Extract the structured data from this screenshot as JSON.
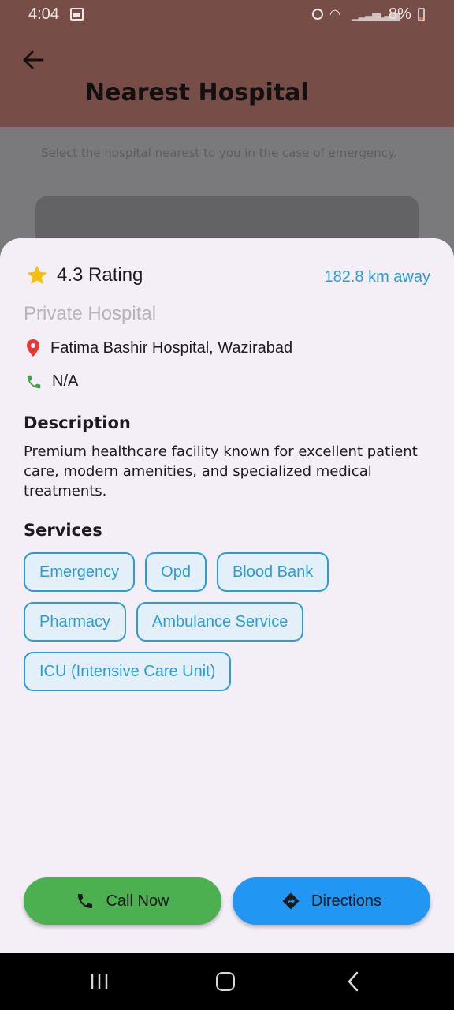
{
  "status_bar": {
    "time": "4:04",
    "battery": "8%"
  },
  "app_bar": {
    "title": "Nearest Hospital"
  },
  "background": {
    "subtitle": "Select the hospital nearest to you in the case of emergency."
  },
  "sheet": {
    "rating": "4.3 Rating",
    "distance": "182.8 km away",
    "type": "Private Hospital",
    "address": "Fatima Bashir Hospital, Wazirabad",
    "phone": "N/A",
    "description_title": "Description",
    "description": "Premium healthcare facility known for excellent patient care, modern amenities, and specialized medical treatments.",
    "services_title": "Services",
    "services": [
      "Emergency",
      "Opd",
      "Blood Bank",
      "Pharmacy",
      "Ambulance Service",
      "ICU (Intensive Care Unit)"
    ],
    "call_button": "Call Now",
    "directions_button": "Directions"
  },
  "colors": {
    "accent": "#2b9bd6",
    "call": "#4caf50",
    "directions": "#2196f3",
    "appbar": "#764e47"
  }
}
